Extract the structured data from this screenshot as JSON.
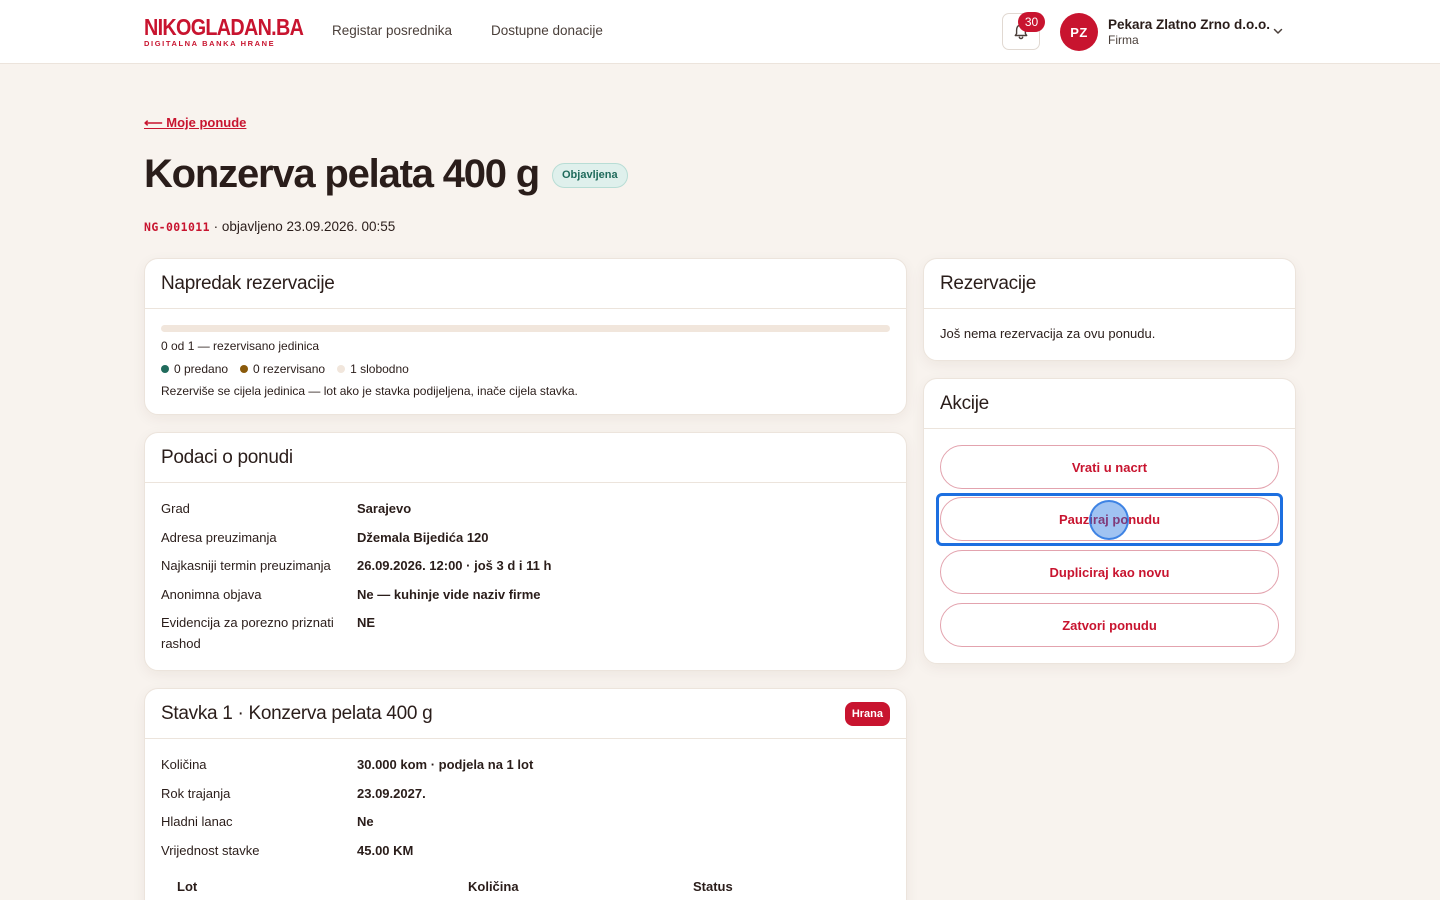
{
  "header": {
    "logo_main": "NIKOGLADAN.BA",
    "logo_sub": "DIGITALNA BANKA HRANE",
    "nav": [
      "Registar posrednika",
      "Dostupne donacije"
    ],
    "notifications_count": "30",
    "user_initials": "PZ",
    "user_name": "Pekara Zlatno Zrno d.o.o.",
    "user_role": "Firma"
  },
  "page": {
    "back_label": "⟵ Moje ponude",
    "title": "Konzerva pelata 400 g",
    "status": "Objavljena",
    "code": "NG-001011",
    "published": " · objavljeno 23.09.2026. 00:55"
  },
  "progress": {
    "title": "Napredak rezervacije",
    "fraction": 0,
    "summary": "0 od 1 — rezervisano jedinica",
    "legend": [
      "0 predano",
      "0 rezervisano",
      "1 slobodno"
    ],
    "note": "Rezerviše se cijela jedinica — lot ako je stavka podijeljena, inače cijela stavka."
  },
  "details": {
    "title": "Podaci o ponudi",
    "rows": [
      {
        "key": "Grad",
        "value": "Sarajevo"
      },
      {
        "key": "Adresa preuzimanja",
        "value": "Džemala Bijedića 120"
      },
      {
        "key": "Najkasniji termin preuzimanja",
        "value": "26.09.2026. 12:00 · još 3 d i 11 h"
      },
      {
        "key": "Anonimna objava",
        "value": "Ne — kuhinje vide naziv firme"
      },
      {
        "key": "Evidencija za porezno priznati rashod",
        "value": "NE"
      }
    ]
  },
  "item": {
    "title": "Stavka 1 · Konzerva pelata 400 g",
    "category": "Hrana",
    "rows": [
      {
        "key": "Količina",
        "value": "30.000 kom · podjela na 1 lot"
      },
      {
        "key": "Rok trajanja",
        "value": "23.09.2027."
      },
      {
        "key": "Hladni lanac",
        "value": "Ne"
      },
      {
        "key": "Vrijednost stavke",
        "value": "45.00 KM"
      }
    ],
    "lot_columns": [
      "Lot",
      "Količina",
      "Status"
    ]
  },
  "reservations": {
    "title": "Rezervacije",
    "empty_text": "Još nema rezervacija za ovu ponudu."
  },
  "actions": {
    "title": "Akcije",
    "buttons": [
      "Vrati u nacrt",
      "Pauziraj ponudu",
      "Dupliciraj kao novu",
      "Zatvori ponudu"
    ]
  },
  "colors": {
    "brand": "#c8142f",
    "delivered": "#206b5c",
    "reserved": "#8a5a0b",
    "free": "#f1e6dc",
    "focus": "#1d6fe0"
  }
}
